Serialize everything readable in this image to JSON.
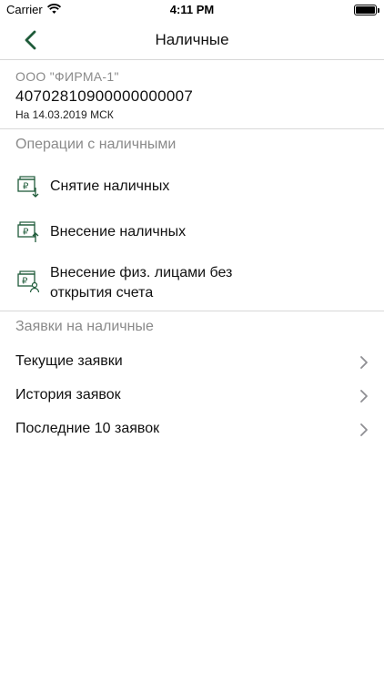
{
  "status": {
    "carrier": "Carrier",
    "time": "4:11 PM"
  },
  "nav": {
    "title": "Наличные"
  },
  "account": {
    "company": "ООО \"ФИРМА-1\"",
    "number": "40702810900000000007",
    "date": "На 14.03.2019 МСК"
  },
  "operations": {
    "header": "Операции с наличными",
    "items": [
      {
        "label": "Снятие наличных",
        "icon": "cash-withdraw-icon"
      },
      {
        "label": "Внесение наличных",
        "icon": "cash-deposit-icon"
      },
      {
        "label_line1": "Внесение физ. лицами без",
        "label_line2": "открытия счета",
        "icon": "cash-person-icon"
      }
    ]
  },
  "requests": {
    "header": "Заявки на наличные",
    "items": [
      {
        "label": "Текущие заявки"
      },
      {
        "label": "История заявок"
      },
      {
        "label": "Последние 10 заявок"
      }
    ]
  },
  "colors": {
    "accent": "#1f5b3a",
    "muted": "#8a8a8a",
    "divider": "#d8d8d8"
  }
}
